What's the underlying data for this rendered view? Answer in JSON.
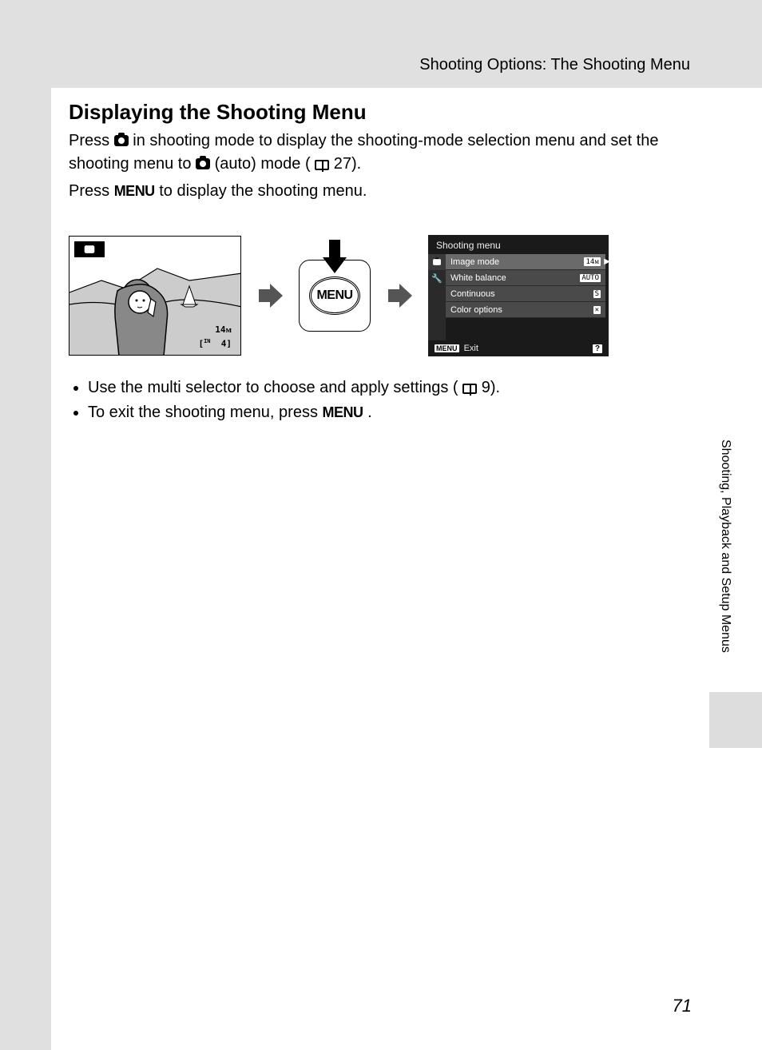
{
  "header": "Shooting Options: The Shooting Menu",
  "section_title": "Displaying the Shooting Menu",
  "para1_a": "Press ",
  "para1_b": " in shooting mode to display the shooting-mode selection menu and set the shooting menu to ",
  "para1_c": " (auto) mode (",
  "para1_d": " 27).",
  "para2_a": "Press ",
  "para2_b": " to display the shooting menu.",
  "menu_button_label": "MENU",
  "menu_label": "MENU",
  "camera_shot": {
    "image_mode_badge": "14ᴍ",
    "remaining_a": "[",
    "remaining_b": "4]"
  },
  "shooting_menu": {
    "title": "Shooting menu",
    "items": [
      {
        "label": "Image mode",
        "value": "14ᴍ",
        "selected": true
      },
      {
        "label": "White balance",
        "value": "AUTO",
        "selected": false
      },
      {
        "label": "Continuous",
        "value": "S",
        "selected": false
      },
      {
        "label": "Color options",
        "value": "✕",
        "selected": false
      }
    ],
    "exit_badge": "MENU",
    "exit_label": "Exit",
    "help_badge": "?"
  },
  "bullets": {
    "b1_a": "Use the multi selector to choose and apply settings (",
    "b1_b": " 9).",
    "b2_a": "To exit the shooting menu, press ",
    "b2_b": "."
  },
  "side_label": "Shooting, Playback and Setup Menus",
  "page_number": "71"
}
